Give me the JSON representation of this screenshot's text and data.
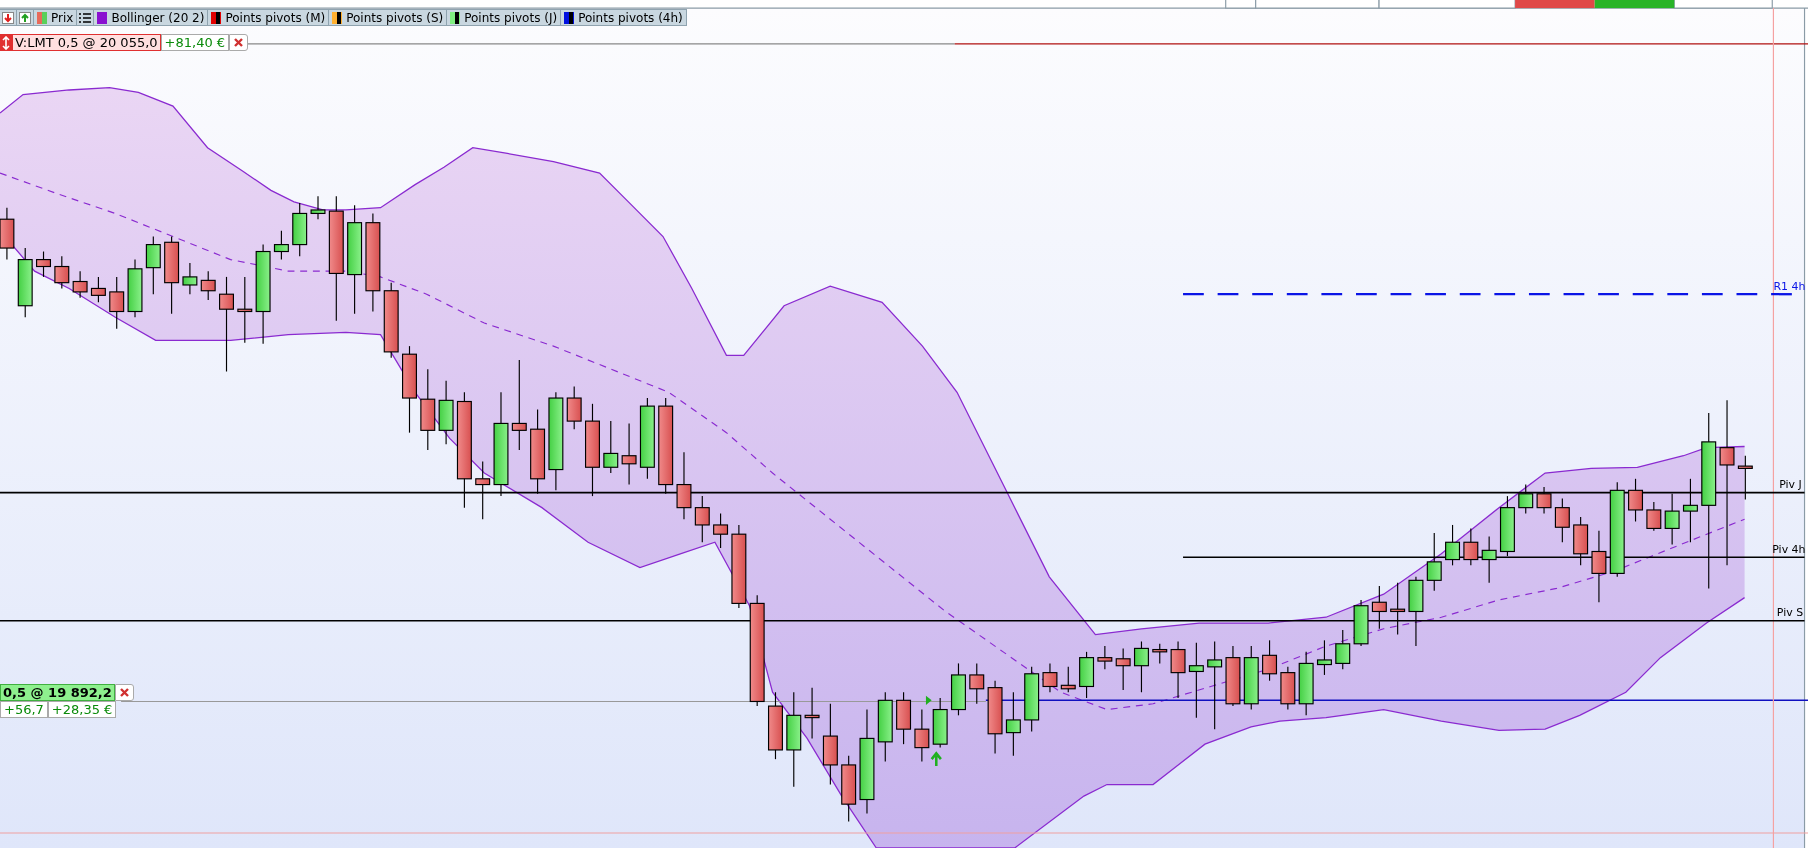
{
  "toolbar": {
    "items": [
      {
        "kind": "price",
        "label": "Prix",
        "color": "#e86a5a"
      },
      {
        "kind": "band",
        "label": "Bollinger (20 2)",
        "color": "#8a10d0"
      },
      {
        "kind": "pivot",
        "label": "Points pivots (M)",
        "color": "#e00000"
      },
      {
        "kind": "pivot",
        "label": "Points pivots (S)",
        "color": "#ffb030"
      },
      {
        "kind": "pivot",
        "label": "Points pivots (J)",
        "color": "#80f080"
      },
      {
        "kind": "pivot",
        "label": "Points pivots (4h)",
        "color": "#0010e0"
      }
    ]
  },
  "orders": [
    {
      "kind": "limit",
      "label": "V:LMT 0,5 @ 20 055,0",
      "pnl": "+81,40 €"
    },
    {
      "kind": "position",
      "label": "0,5 @ 19 892,2",
      "points": "+56,7",
      "pnl": "+28,35 €"
    }
  ],
  "levels": [
    {
      "kind": "dashed",
      "label": "R1 4h",
      "color": "#0a14e6"
    },
    {
      "kind": "solid",
      "label": "Piv J",
      "color": "#000000"
    },
    {
      "kind": "solid",
      "label": "Piv 4h",
      "color": "#000000"
    },
    {
      "kind": "solid",
      "label": "Piv S",
      "color": "#000000"
    }
  ]
}
